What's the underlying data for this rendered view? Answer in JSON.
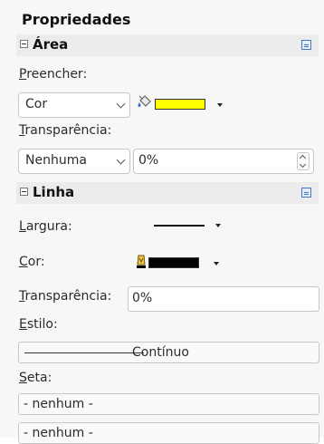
{
  "panel": {
    "title": "Propriedades"
  },
  "area": {
    "title": "Área",
    "fill": {
      "label": "Preencher:",
      "type_value": "Cor",
      "color": "#ffff00"
    },
    "transparency": {
      "label": "Transparência:",
      "type_value": "Nenhuma",
      "value": "0%"
    }
  },
  "line": {
    "title": "Linha",
    "width_label": "Largura:",
    "color_label": "Cor:",
    "color": "#000000",
    "transparency_label": "Transparência:",
    "transparency_value": "0%",
    "style_label": "Estilo:",
    "style_value": "Contínuo",
    "arrow_label": "Seta:",
    "arrow_start": "- nenhum -",
    "arrow_end": "- nenhum -"
  },
  "icons": {
    "collapse": "collapse-icon",
    "more_options": "more-options-icon",
    "fill_bucket": "paint-bucket-icon",
    "line_color": "pen-icon",
    "dropdown": "dropdown-arrow-icon"
  }
}
